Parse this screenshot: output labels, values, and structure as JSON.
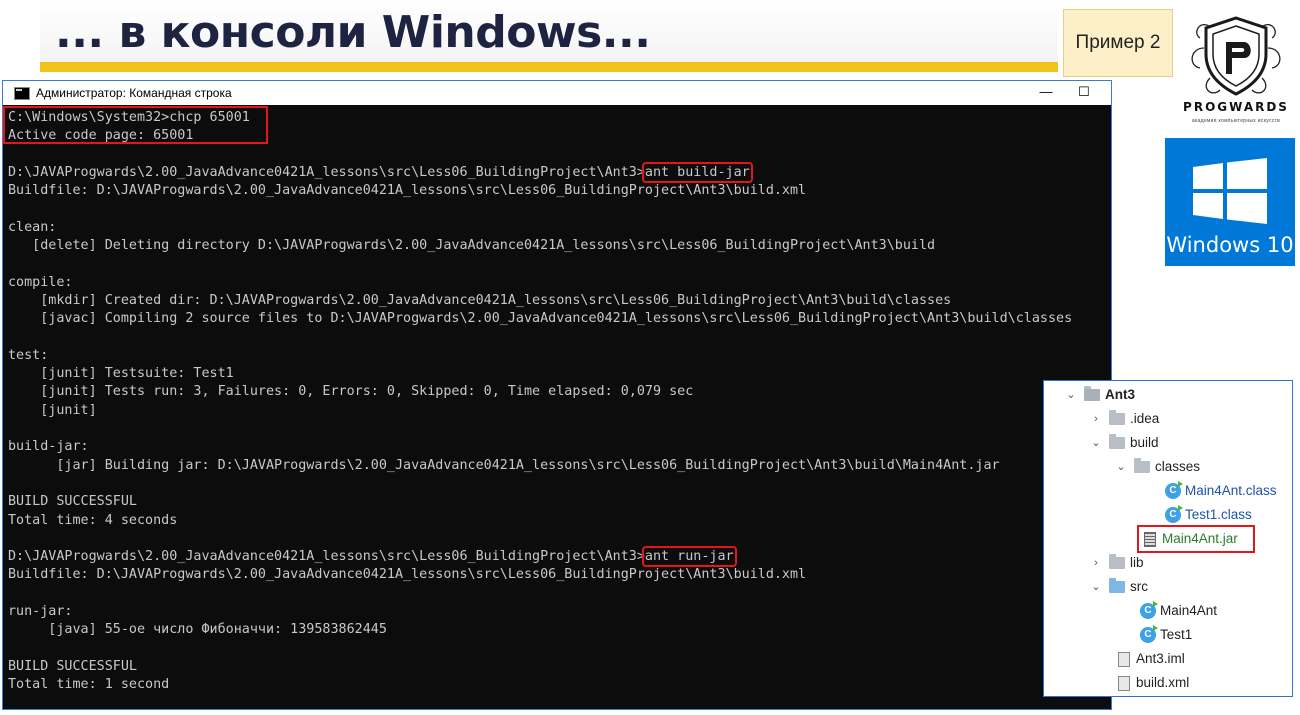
{
  "slide": {
    "title": "... в консоли Windows...",
    "example_label": "Пример 2",
    "logo_name": "PROGWARDS",
    "logo_tagline": "академия компьютерных искусств",
    "windows_label": "Windows 10",
    "accent_color": "#f1c21b"
  },
  "console": {
    "window_title": "Администратор: Командная строка",
    "controls": {
      "minimize": "—",
      "maximize": "☐"
    },
    "lines": [
      "C:\\Windows\\System32>chcp 65001",
      "Active code page: 65001",
      "",
      "D:\\JAVAProgwards\\2.00_JavaAdvance0421A_lessons\\src\\Less06_BuildingProject\\Ant3>",
      "Buildfile: D:\\JAVAProgwards\\2.00_JavaAdvance0421A_lessons\\src\\Less06_BuildingProject\\Ant3\\build.xml",
      "",
      "clean:",
      "   [delete] Deleting directory D:\\JAVAProgwards\\2.00_JavaAdvance0421A_lessons\\src\\Less06_BuildingProject\\Ant3\\build",
      "",
      "compile:",
      "    [mkdir] Created dir: D:\\JAVAProgwards\\2.00_JavaAdvance0421A_lessons\\src\\Less06_BuildingProject\\Ant3\\build\\classes",
      "    [javac] Compiling 2 source files to D:\\JAVAProgwards\\2.00_JavaAdvance0421A_lessons\\src\\Less06_BuildingProject\\Ant3\\build\\classes",
      "",
      "test:",
      "    [junit] Testsuite: Test1",
      "    [junit] Tests run: 3, Failures: 0, Errors: 0, Skipped: 0, Time elapsed: 0,079 sec",
      "    [junit]",
      "",
      "build-jar:",
      "      [jar] Building jar: D:\\JAVAProgwards\\2.00_JavaAdvance0421A_lessons\\src\\Less06_BuildingProject\\Ant3\\build\\Main4Ant.jar",
      "",
      "BUILD SUCCESSFUL",
      "Total time: 4 seconds",
      "",
      "D:\\JAVAProgwards\\2.00_JavaAdvance0421A_lessons\\src\\Less06_BuildingProject\\Ant3>",
      "Buildfile: D:\\JAVAProgwards\\2.00_JavaAdvance0421A_lessons\\src\\Less06_BuildingProject\\Ant3\\build.xml",
      "",
      "run-jar:",
      "     [java] 55-ое число Фибоначчи: 139583862445",
      "",
      "BUILD SUCCESSFUL",
      "Total time: 1 second"
    ],
    "commands": {
      "build": "ant build-jar",
      "run": "ant run-jar"
    },
    "highlight_color": "#e3161c"
  },
  "project_tree": {
    "root": "Ant3",
    "items": [
      {
        "label": "Ant3",
        "icon": "project-folder-icon"
      },
      {
        "label": ".idea",
        "icon": "folder-icon"
      },
      {
        "label": "build",
        "icon": "folder-icon"
      },
      {
        "label": "classes",
        "icon": "folder-icon"
      },
      {
        "label": "Main4Ant.class",
        "icon": "class-icon"
      },
      {
        "label": "Test1.class",
        "icon": "class-icon"
      },
      {
        "label": "Main4Ant.jar",
        "icon": "jar-icon"
      },
      {
        "label": "lib",
        "icon": "folder-icon"
      },
      {
        "label": "src",
        "icon": "source-folder-icon"
      },
      {
        "label": "Main4Ant",
        "icon": "class-icon"
      },
      {
        "label": "Test1",
        "icon": "class-icon"
      },
      {
        "label": "Ant3.iml",
        "icon": "module-file-icon"
      },
      {
        "label": "build.xml",
        "icon": "xml-file-icon"
      }
    ]
  }
}
